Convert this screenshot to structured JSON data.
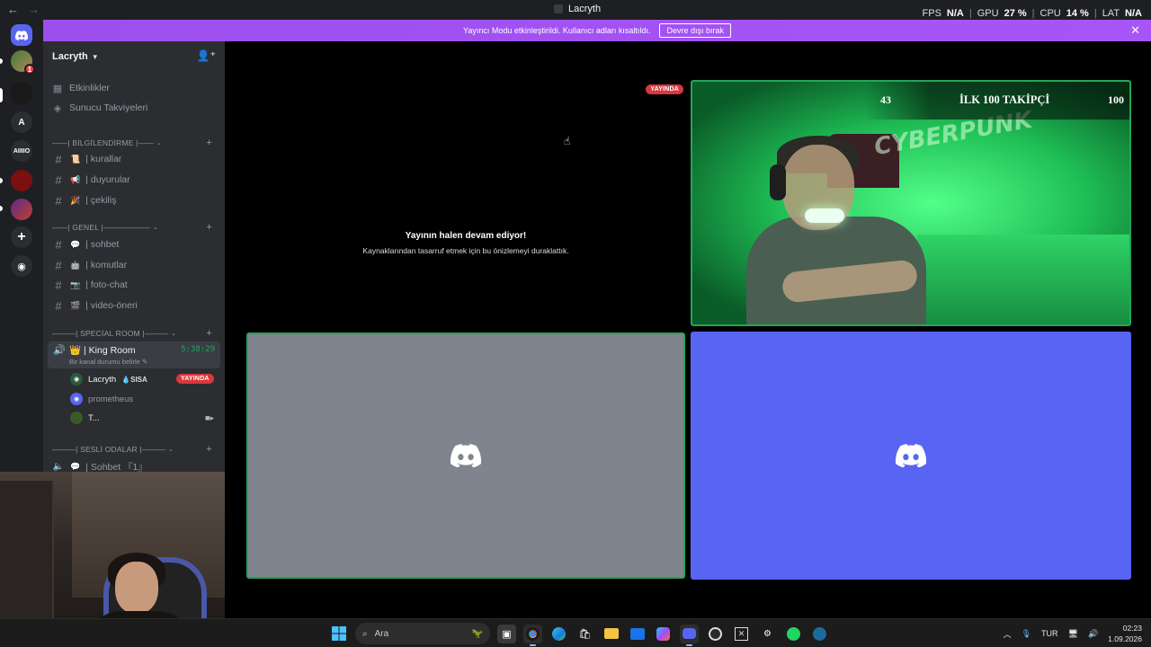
{
  "titlebar": {
    "title": "Lacryth",
    "stats": {
      "fps_label": "FPS",
      "fps_value": "N/A",
      "gpu_label": "GPU",
      "gpu_value": "27 %",
      "cpu_label": "CPU",
      "cpu_value": "14 %",
      "lat_label": "LAT",
      "lat_value": "N/A"
    }
  },
  "banner": {
    "text": "Yayıncı Modu etkinleştirildi. Kullanıcı adları kısaltıldı.",
    "button": "Devre dışı bırak"
  },
  "rail": {
    "servers": [
      {
        "label": "A"
      },
      {
        "label": "AIIIIO"
      }
    ],
    "badge_count": "1"
  },
  "sidebar": {
    "server_name": "Lacryth",
    "top_items": [
      {
        "label": "Etkinlikler",
        "icon": "calendar-icon"
      },
      {
        "label": "Sunucu Takviyeleri",
        "icon": "boost-icon"
      }
    ],
    "categories": {
      "bilgi": "——| BİLGİLENDİRME |——",
      "genel": "——| GENEL |——————",
      "special": "———| SPECİAL ROOM |———",
      "sesli": "———| SESLİ ODALAR |———"
    },
    "channels_bilgi": [
      "| kurallar",
      "| duyurular",
      "| çekiliş"
    ],
    "channels_genel": [
      "| sohbet",
      "| komutlar",
      "| foto-chat",
      "| video-öneri"
    ],
    "voice": {
      "name": "| King Room",
      "timer": "5:38:29",
      "status": "Bir kanal durumu belirle"
    },
    "voice_users": [
      {
        "name": "Lacryth",
        "tag": "SISA",
        "live": "YAYINDA"
      },
      {
        "name": "prometheus"
      },
      {
        "name": "T..."
      }
    ],
    "sesli_channel": "| Sohbet 『1』"
  },
  "stage": {
    "paused_title": "Yayının halen devam ediyor!",
    "paused_sub": "Kaynaklarından tasarruf etmek için bu önizlemeyi duraklattık.",
    "live_label": "YAYINDA",
    "overlay_left": "43",
    "overlay_mid": "İLK 100 TAKİPÇİ",
    "overlay_right": "100",
    "poster_text": "CYBERPUNK"
  },
  "taskbar": {
    "search_placeholder": "Ara",
    "lang": "TUR",
    "time": "02:23",
    "date": "1.09.2026"
  },
  "colors": {
    "banner": "#a855f7",
    "green": "#23a55a",
    "blurple": "#5865f2",
    "live": "#da373c"
  }
}
